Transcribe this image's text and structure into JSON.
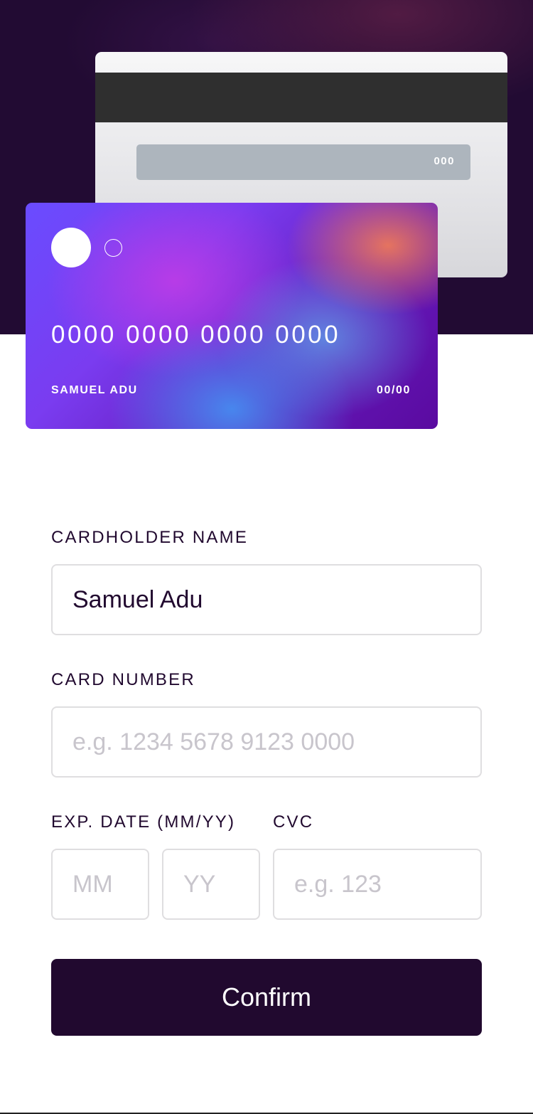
{
  "card_back": {
    "cvc": "000"
  },
  "card_front": {
    "number": "0000 0000 0000 0000",
    "holder": "SAMUEL ADU",
    "expiry": "00/00"
  },
  "form": {
    "name_label": "CARDHOLDER NAME",
    "name_value": "Samuel Adu",
    "number_label": "CARD NUMBER",
    "number_placeholder": "e.g. 1234 5678 9123 0000",
    "exp_label": "EXP. DATE (MM/YY)",
    "month_placeholder": "MM",
    "year_placeholder": "YY",
    "cvc_label": "CVC",
    "cvc_placeholder": "e.g. 123",
    "confirm_label": "Confirm"
  },
  "colors": {
    "dark_violet": "#21092f",
    "border": "#dfdee0",
    "placeholder": "#c8c5cc"
  }
}
